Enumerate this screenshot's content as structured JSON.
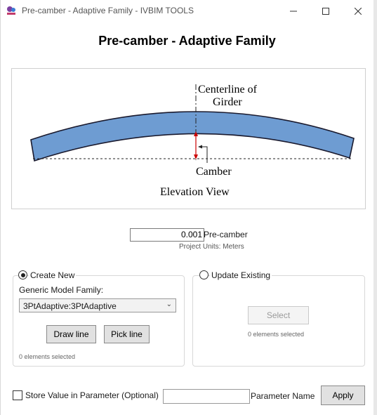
{
  "window": {
    "title": "Pre-camber - Adaptive Family - IVBIM TOOLS",
    "minimize_icon": "minimize-icon",
    "maximize_icon": "maximize-icon",
    "close_icon": "close-icon"
  },
  "heading": "Pre-camber - Adaptive Family",
  "diagram": {
    "centerline_line1": "Centerline of",
    "centerline_line2": "Girder",
    "camber_label": "Camber",
    "view_label": "Elevation View",
    "girder_color": "#6e9cd2"
  },
  "precamber": {
    "value": "0.001",
    "label": "Pre-camber",
    "units": "Project Units: Meters"
  },
  "create_new": {
    "label": "Create New",
    "selected": true,
    "family_label": "Generic Model Family:",
    "family_value": "3PtAdaptive:3PtAdaptive",
    "draw_line": "Draw line",
    "pick_line": "Pick line",
    "status": "0 elements selected"
  },
  "update_existing": {
    "label": "Update Existing",
    "selected": false,
    "select_button": "Select",
    "status": "0 elements selected"
  },
  "footer": {
    "store_checkbox_label": "Store Value in Parameter (Optional)",
    "store_checked": false,
    "parameter_value": "",
    "parameter_name_label": "Parameter Name",
    "apply_button": "Apply"
  }
}
